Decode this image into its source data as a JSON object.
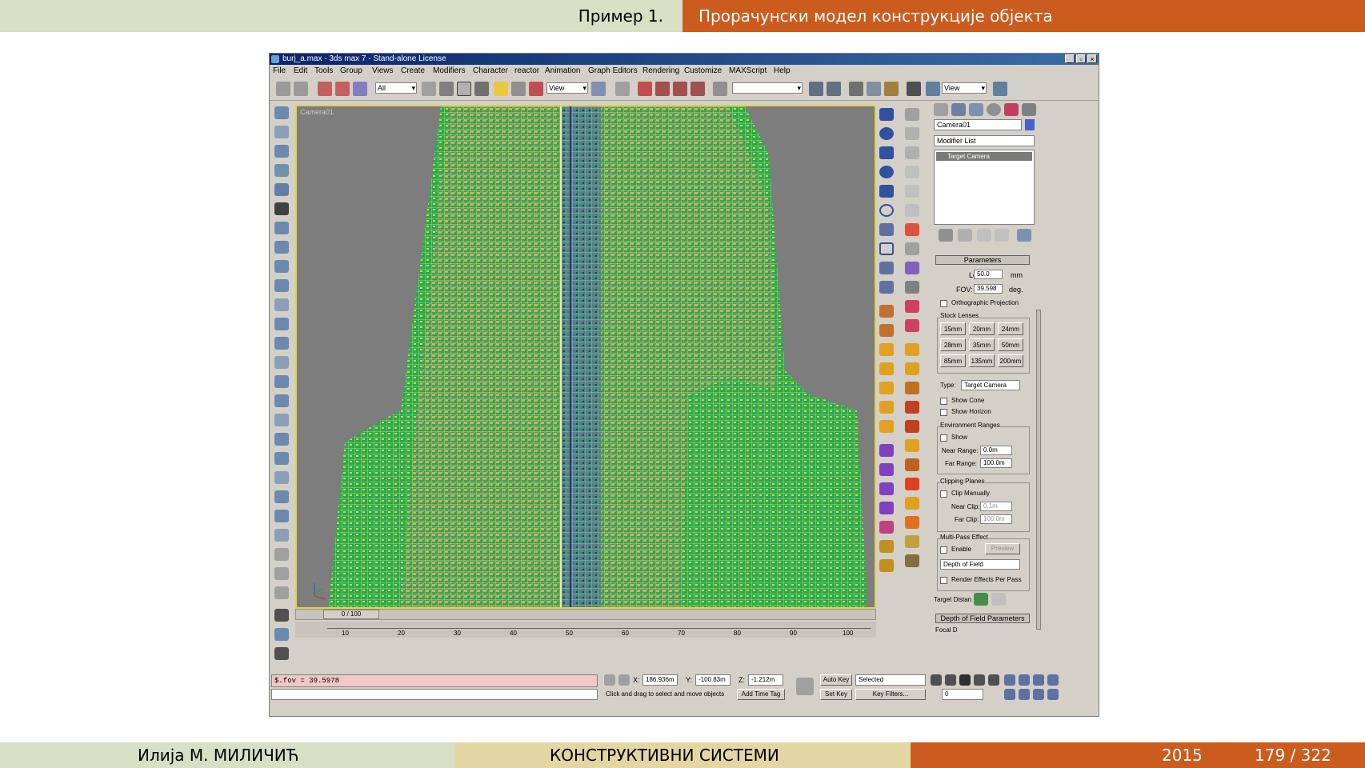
{
  "slide": {
    "section": "Пример 1.",
    "title": "Прорачунски модел конструкције објекта",
    "author": "Илија М. МИЛИЧИЋ",
    "course": "КОНСТРУКТИВНИ СИСТЕМИ",
    "year": "2015",
    "page": "179 / 322"
  },
  "app": {
    "window_title": "burj_a.max - 3ds max 7 - Stand-alone License",
    "menu": [
      "File",
      "Edit",
      "Tools",
      "Group",
      "Views",
      "Create",
      "Modifiers",
      "Character",
      "reactor",
      "Animation",
      "Graph Editors",
      "Rendering",
      "Customize",
      "MAXScript",
      "Help"
    ],
    "toolbar": {
      "selection_filter": "All",
      "ref_coord": "View",
      "view_dropdown": "View"
    },
    "viewport": {
      "label": "Camera01"
    },
    "panel": {
      "object_name": "Camera01",
      "modifier_list": "Modifier List",
      "stack_item": "Target Camera",
      "parameters_title": "Parameters",
      "lens_label": "Lens:",
      "lens_value": "50.0",
      "lens_unit": "mm",
      "fov_label": "FOV:",
      "fov_value": "39.598",
      "fov_unit": "deg.",
      "ortho_label": "Orthographic Projection",
      "stock_lenses_label": "Stock Lenses",
      "lenses": [
        "15mm",
        "20mm",
        "24mm",
        "28mm",
        "35mm",
        "50mm",
        "85mm",
        "135mm",
        "200mm"
      ],
      "type_label": "Type:",
      "type_value": "Target Camera",
      "show_cone": "Show Cone",
      "show_horizon": "Show Horizon",
      "env_ranges": "Environment Ranges",
      "env_show": "Show",
      "near_range_label": "Near Range:",
      "near_range_value": "0.0m",
      "far_range_label": "Far Range:",
      "far_range_value": "100.0m",
      "clipping_planes": "Clipping Planes",
      "clip_manually": "Clip Manually",
      "near_clip_label": "Near Clip:",
      "near_clip_value": "0.1m",
      "far_clip_label": "Far Clip:",
      "far_clip_value": "100.0m",
      "multipass": "Multi-Pass Effect",
      "enable": "Enable",
      "preview": "Preview",
      "effect_value": "Depth of Field",
      "render_effects": "Render Effects Per Pass",
      "target_distance": "Target Distan",
      "dof_params": "Depth of Field Parameters",
      "focal": "Focal D"
    },
    "timeline": {
      "frame": "0 / 100",
      "ticks": [
        "0",
        "10",
        "20",
        "30",
        "40",
        "50",
        "60",
        "70",
        "80",
        "90",
        "100"
      ]
    },
    "status": {
      "script": "$.fov = 39.5978",
      "x_label": "X:",
      "x_value": "186.936m",
      "y_label": "Y:",
      "y_value": "-100.83m",
      "z_label": "Z:",
      "z_value": "-1.212m",
      "prompt": "Click and drag to select and move objects",
      "add_time_tag": "Add Time Tag",
      "auto_key": "Auto Key",
      "set_key": "Set Key",
      "selected": "Selected",
      "key_filters": "Key Filters...",
      "frame_field": "0"
    }
  }
}
